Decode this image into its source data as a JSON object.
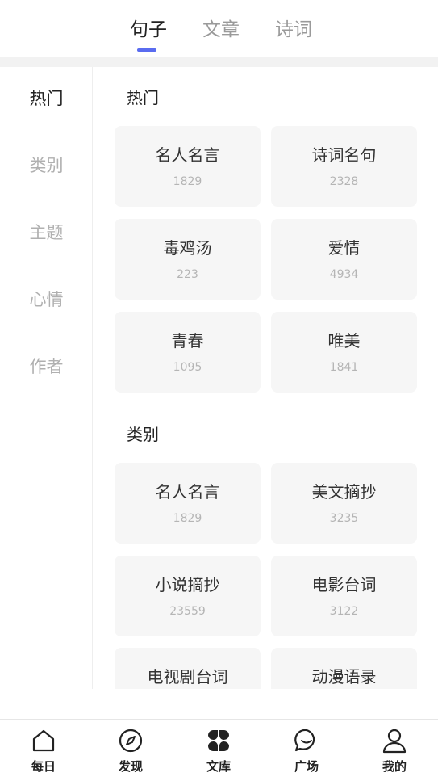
{
  "top_tabs": [
    {
      "label": "句子",
      "active": true
    },
    {
      "label": "文章",
      "active": false
    },
    {
      "label": "诗词",
      "active": false
    }
  ],
  "colors": {
    "accent": "#5a6cf0",
    "card_bg": "#f6f6f6",
    "inactive_text": "#b0b0b0"
  },
  "side_nav": [
    {
      "label": "热门",
      "active": true
    },
    {
      "label": "类别",
      "active": false
    },
    {
      "label": "主题",
      "active": false
    },
    {
      "label": "心情",
      "active": false
    },
    {
      "label": "作者",
      "active": false
    }
  ],
  "sections": [
    {
      "title": "热门",
      "cards": [
        {
          "name": "名人名言",
          "count": "1829"
        },
        {
          "name": "诗词名句",
          "count": "2328"
        },
        {
          "name": "毒鸡汤",
          "count": "223"
        },
        {
          "name": "爱情",
          "count": "4934"
        },
        {
          "name": "青春",
          "count": "1095"
        },
        {
          "name": "唯美",
          "count": "1841"
        }
      ]
    },
    {
      "title": "类别",
      "cards": [
        {
          "name": "名人名言",
          "count": "1829"
        },
        {
          "name": "美文摘抄",
          "count": "3235"
        },
        {
          "name": "小说摘抄",
          "count": "23559"
        },
        {
          "name": "电影台词",
          "count": "3122"
        },
        {
          "name": "电视剧台词",
          "count": ""
        },
        {
          "name": "动漫语录",
          "count": ""
        }
      ]
    }
  ],
  "bottom_nav": [
    {
      "label": "每日",
      "icon": "home-icon"
    },
    {
      "label": "发现",
      "icon": "compass-icon"
    },
    {
      "label": "文库",
      "icon": "library-grid-icon",
      "active": true
    },
    {
      "label": "广场",
      "icon": "chat-bubble-icon"
    },
    {
      "label": "我的",
      "icon": "user-icon"
    }
  ]
}
